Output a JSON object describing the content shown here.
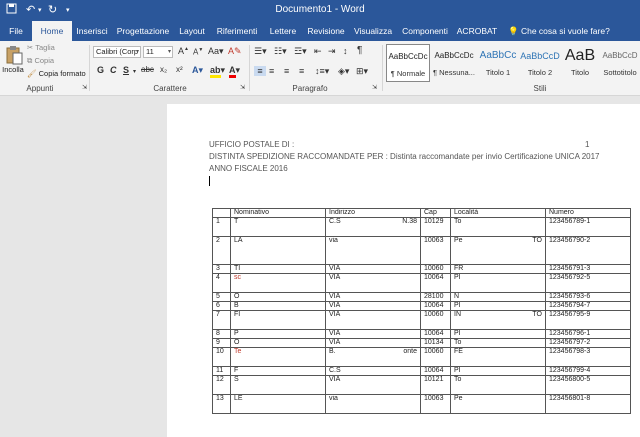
{
  "window": {
    "title": "Documento1 - Word"
  },
  "quick_access": {
    "save_icon": "save-icon",
    "undo_icon": "undo-icon",
    "redo_icon": "redo-icon",
    "customize_icon": "customize-quick-access-icon"
  },
  "tabs": [
    {
      "label": "File",
      "active": false
    },
    {
      "label": "Home",
      "active": true
    },
    {
      "label": "Inserisci",
      "active": false
    },
    {
      "label": "Progettazione",
      "active": false
    },
    {
      "label": "Layout",
      "active": false
    },
    {
      "label": "Riferimenti",
      "active": false
    },
    {
      "label": "Lettere",
      "active": false
    },
    {
      "label": "Revisione",
      "active": false
    },
    {
      "label": "Visualizza",
      "active": false
    },
    {
      "label": "Componenti",
      "active": false
    },
    {
      "label": "ACROBAT",
      "active": false
    }
  ],
  "tell_me": "Che cosa si vuole fare?",
  "clipboard": {
    "paste_label": "Incolla",
    "cut_label": "Taglia",
    "copy_label": "Copia",
    "format_painter_label": "Copia formato",
    "group_label": "Appunti"
  },
  "font": {
    "font_name": "Calibri (Corp",
    "font_size": "11",
    "group_label": "Carattere",
    "bold": "G",
    "italic": "C",
    "underline": "S",
    "strike": "abc",
    "subscript": "x₂",
    "superscript": "x²"
  },
  "paragraph": {
    "group_label": "Paragrafo"
  },
  "styles": {
    "group_label": "Stili",
    "items": [
      {
        "preview": "AaBbCcDc",
        "name": "¶ Normale",
        "selected": true
      },
      {
        "preview": "AaBbCcDc",
        "name": "¶ Nessuna...",
        "selected": false
      },
      {
        "preview": "AaBbCc",
        "name": "Titolo 1",
        "selected": false
      },
      {
        "preview": "AaBbCcD",
        "name": "Titolo 2",
        "selected": false
      },
      {
        "preview": "AaB",
        "name": "Titolo",
        "selected": false
      },
      {
        "preview": "AaBbCcD",
        "name": "Sottotitolo",
        "selected": false
      }
    ]
  },
  "document": {
    "page_number": "1",
    "header_line1": "UFFICIO POSTALE DI :",
    "header_line2": "DISTINTA SPEDIZIONE RACCOMANDATE PER : Distinta raccomandate per invio Certificazione UNICA 2017",
    "header_line3": "ANNO FISCALE 2016",
    "table": {
      "columns": [
        "",
        "Nominativo",
        "Indirizzo",
        "Cap",
        "Località",
        "Numero"
      ],
      "rows": [
        {
          "n": "1",
          "nom": "T",
          "ind": "C.S",
          "ind2": "N.38",
          "cap": "10129",
          "loc": "To",
          "num": "123456789-1",
          "h": "med"
        },
        {
          "n": "2",
          "nom": "LA",
          "ind": "via",
          "ind2": "",
          "cap": "10063",
          "loc": "Pe",
          "loc2": "TO",
          "num": "123456790-2",
          "h": "tall"
        },
        {
          "n": "3",
          "nom": "TI",
          "ind": "VIA",
          "ind2": "",
          "cap": "10060",
          "loc": "FR",
          "num": "123456791-3",
          "h": ""
        },
        {
          "n": "4",
          "nom": "sc",
          "ind": "VIA",
          "ind2": "",
          "cap": "10064",
          "loc": "PI",
          "num": "123456792-5",
          "h": "med"
        },
        {
          "n": "5",
          "nom": "O",
          "ind": "VIA",
          "ind2": "",
          "cap": "28100",
          "loc": "N",
          "num": "123456793-6",
          "h": ""
        },
        {
          "n": "6",
          "nom": "B",
          "ind": "VIA",
          "ind2": "",
          "cap": "10064",
          "loc": "PI",
          "num": "123456794-7",
          "h": ""
        },
        {
          "n": "7",
          "nom": "FI",
          "ind": "VIA",
          "ind2": "",
          "cap": "10060",
          "loc": "IN",
          "loc2": "TO",
          "num": "123456795-9",
          "h": "med"
        },
        {
          "n": "8",
          "nom": "P",
          "ind": "VIA",
          "ind2": "",
          "cap": "10064",
          "loc": "PI",
          "num": "123456796-1",
          "h": ""
        },
        {
          "n": "9",
          "nom": "O",
          "ind": "VIA",
          "ind2": "",
          "cap": "10134",
          "loc": "To",
          "num": "123456797-2",
          "h": ""
        },
        {
          "n": "10",
          "nom": "Te",
          "ind": "B.",
          "ind2": "onte",
          "cap": "10060",
          "loc": "FE",
          "num": "123456798-3",
          "h": "med"
        },
        {
          "n": "11",
          "nom": "F",
          "ind": "C.S",
          "ind2": "",
          "cap": "10064",
          "loc": "PI",
          "num": "123456799-4",
          "h": ""
        },
        {
          "n": "12",
          "nom": "S",
          "ind": "VIA",
          "ind2": "",
          "cap": "10121",
          "loc": "To",
          "num": "123456800-5",
          "h": "med"
        },
        {
          "n": "13",
          "nom": "LE",
          "ind": "via",
          "ind2": "",
          "cap": "10063",
          "loc": "Pe",
          "num": "123456801-8",
          "h": "med"
        }
      ]
    }
  }
}
